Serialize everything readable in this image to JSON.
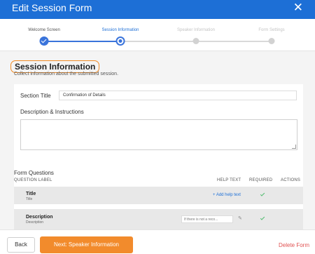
{
  "window": {
    "title": "Edit Session Form",
    "close_glyph": "✕"
  },
  "stepper": {
    "steps": [
      {
        "label": "Welcome Screen",
        "state": "done"
      },
      {
        "label": "Session Information",
        "state": "active"
      },
      {
        "label": "Speaker Information",
        "state": "pending"
      },
      {
        "label": "Form Settings",
        "state": "pending"
      }
    ]
  },
  "section": {
    "title": "Session Information",
    "subtitle": "Collect information about the submitted session."
  },
  "details": {
    "section_title_label": "Section Title",
    "section_title_value": "Confirmation of Details",
    "description_label": "Description & Instructions",
    "description_value": ""
  },
  "questions": {
    "title": "Form Questions",
    "headers": {
      "question_label": "QUESTION LABEL",
      "help_text": "HELP TEXT",
      "required": "REQUIRED",
      "actions": "ACTIONS"
    },
    "rows": [
      {
        "title": "Title",
        "subtitle": "Title",
        "help": "+ Add help text",
        "required": true
      },
      {
        "title": "Description",
        "subtitle": "Description",
        "help": "If there is not a reco...",
        "required": true
      }
    ]
  },
  "footer": {
    "back": "Back",
    "next": "Next: Speaker Information",
    "delete": "Delete Form"
  },
  "colors": {
    "header": "#1d6fd6",
    "accent_orange": "#f28b2c",
    "step_blue": "#3a74db",
    "check_green": "#4cbb6c",
    "delete_red": "#e05050"
  },
  "icons": {
    "close": "close-icon",
    "check": "check-icon",
    "edit": "pencil-icon"
  }
}
